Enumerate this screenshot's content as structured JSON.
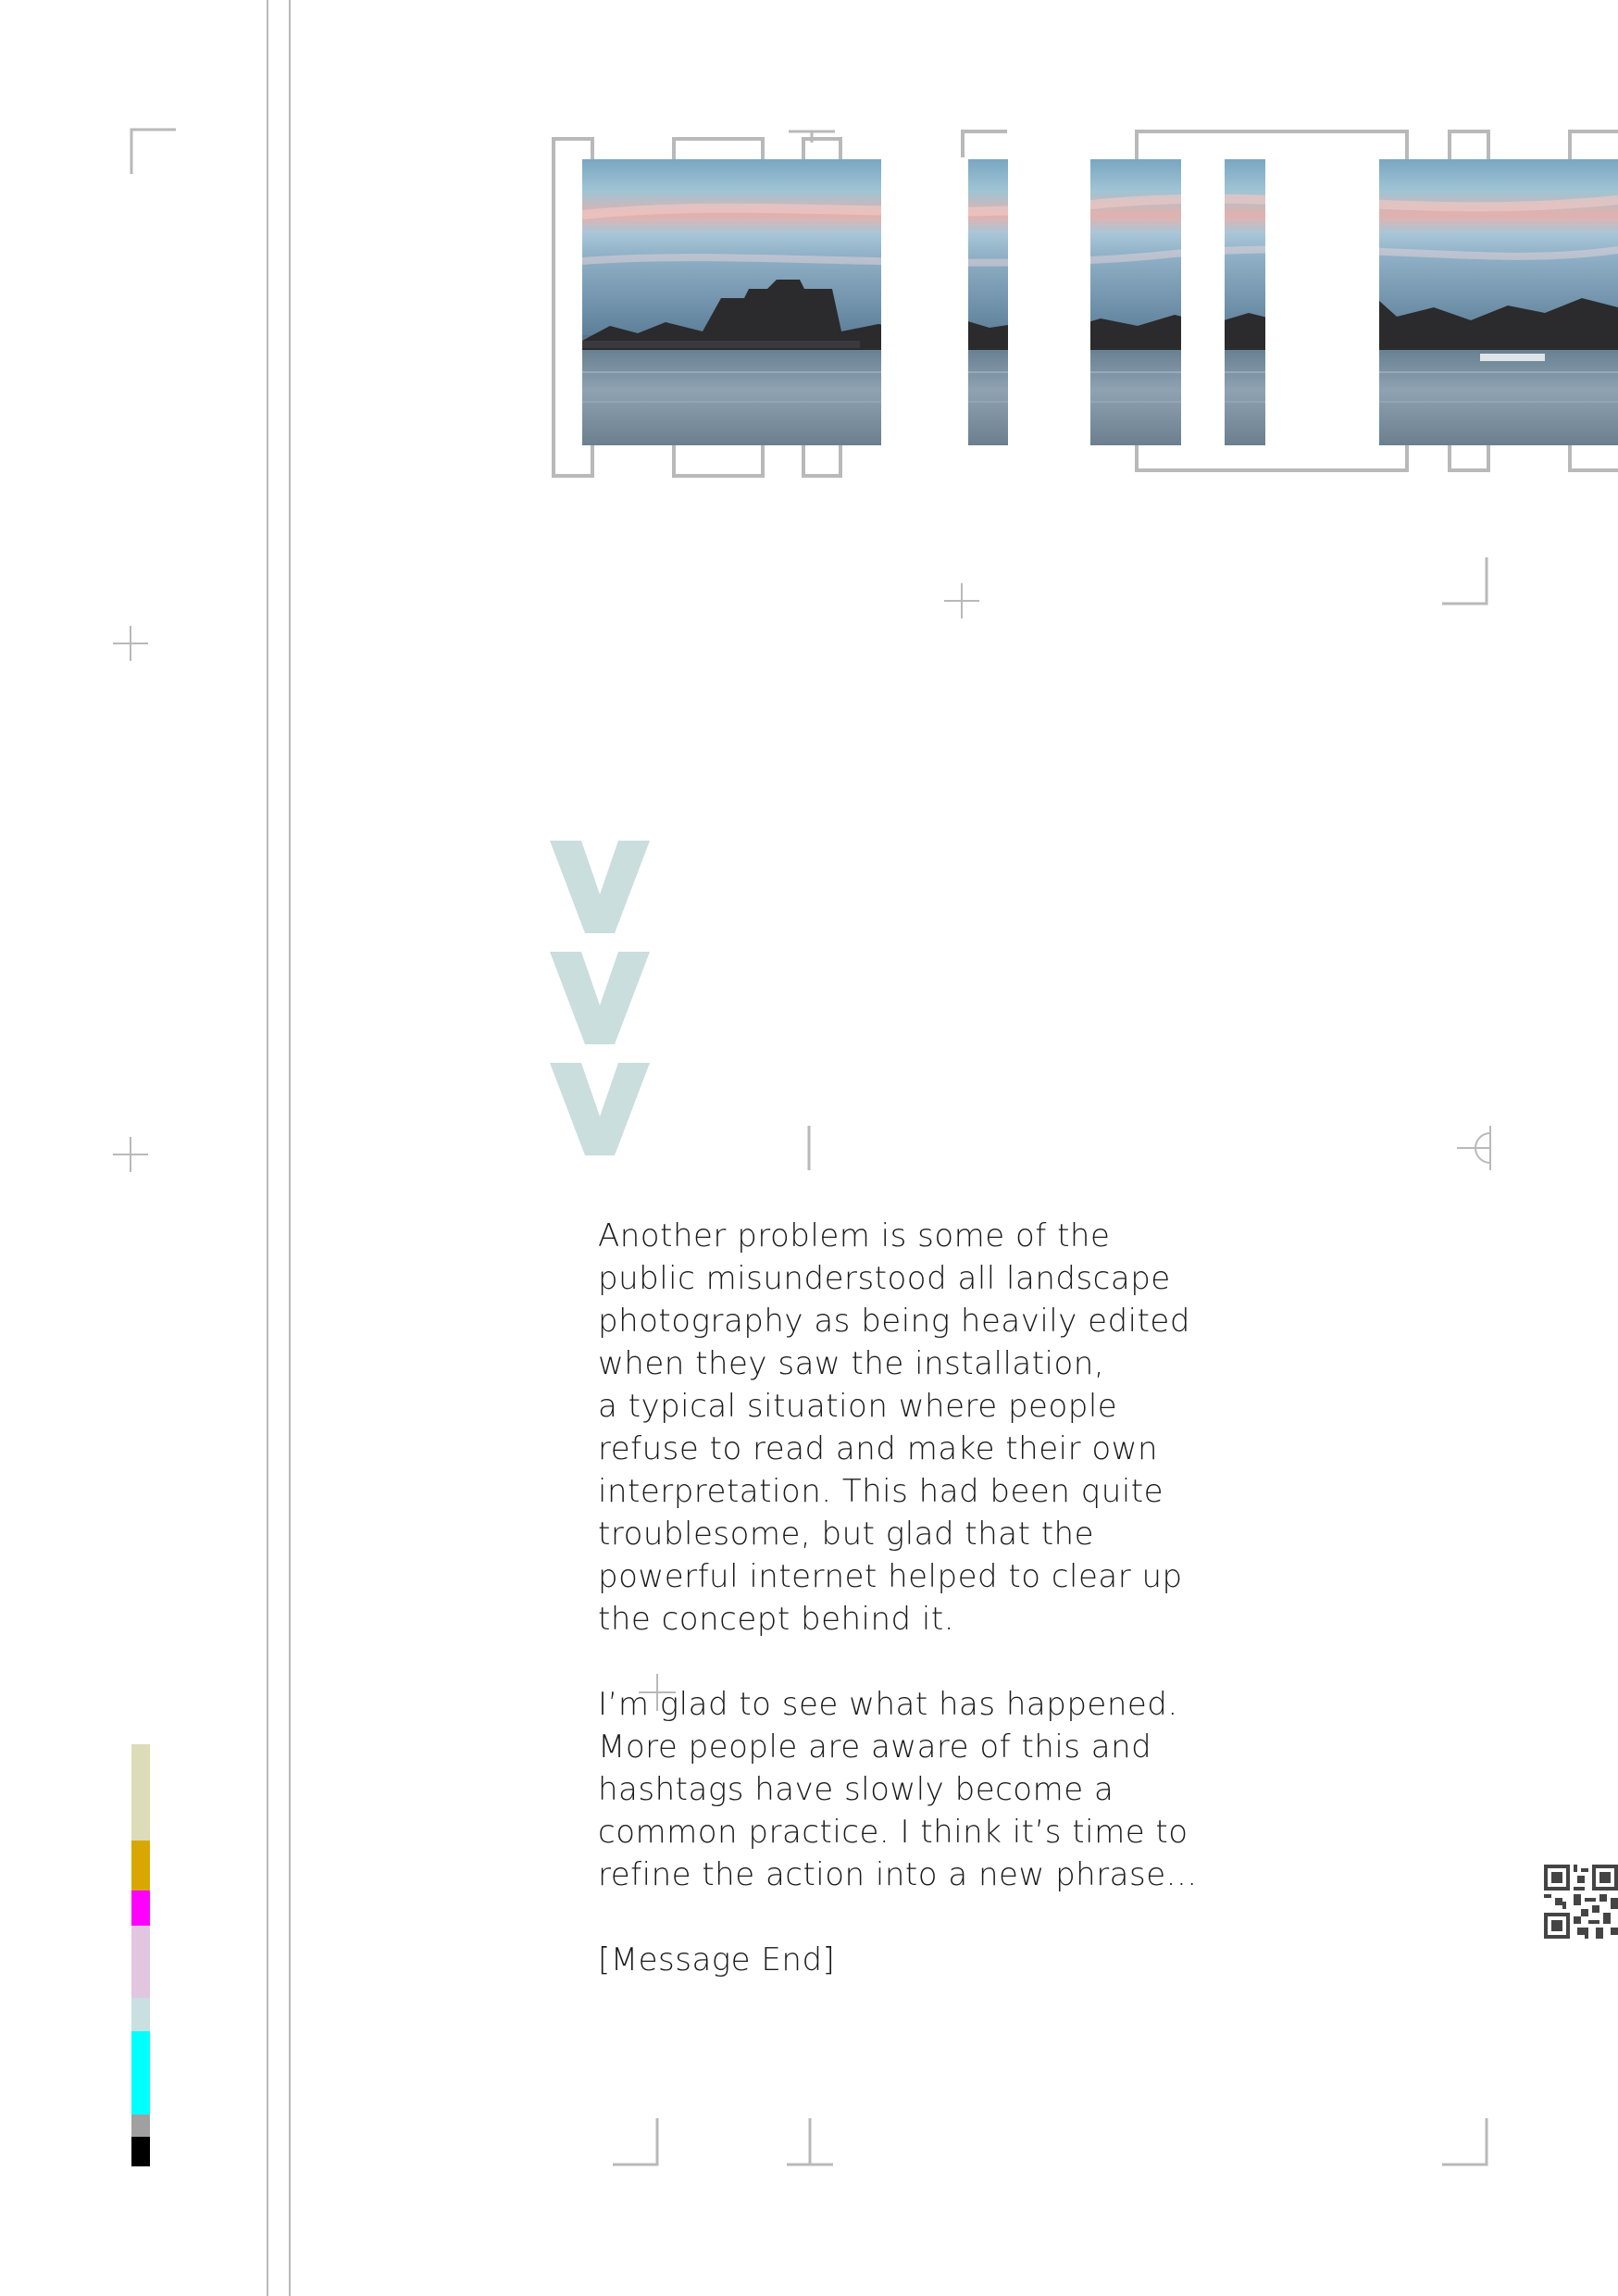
{
  "article": {
    "paragraph_1": "Another problem is some of the\npublic misunderstood all landscape\nphotography as being heavily edited\nwhen they saw the installation,\na typical situation where people\nrefuse to read and make their own\ninterpretation. This had been quite\ntroublesome, but glad that the\npowerful internet helped to clear up\nthe concept behind it.",
    "paragraph_2": "I’m glad to see what has happened.\nMore people are aware of this and\nhashtags have slowly become a\ncommon practice. I think it’s time to\nrefine the action into a new phrase...",
    "closing": "[Message End]"
  },
  "colors": {
    "chevron": "#c9dedd",
    "guide_line": "#b9b9b9",
    "text": "#1a1a1a",
    "swatches": [
      "#dcdcb8",
      "#d9a800",
      "#ff00ff",
      "#e2c6e0",
      "#c8e0e0",
      "#00ffff",
      "#a0a0a0",
      "#000000"
    ]
  },
  "icons": {
    "chevrons": [
      "chevron-down-icon",
      "chevron-down-icon",
      "chevron-down-icon"
    ],
    "qr": "qr-code-icon"
  }
}
